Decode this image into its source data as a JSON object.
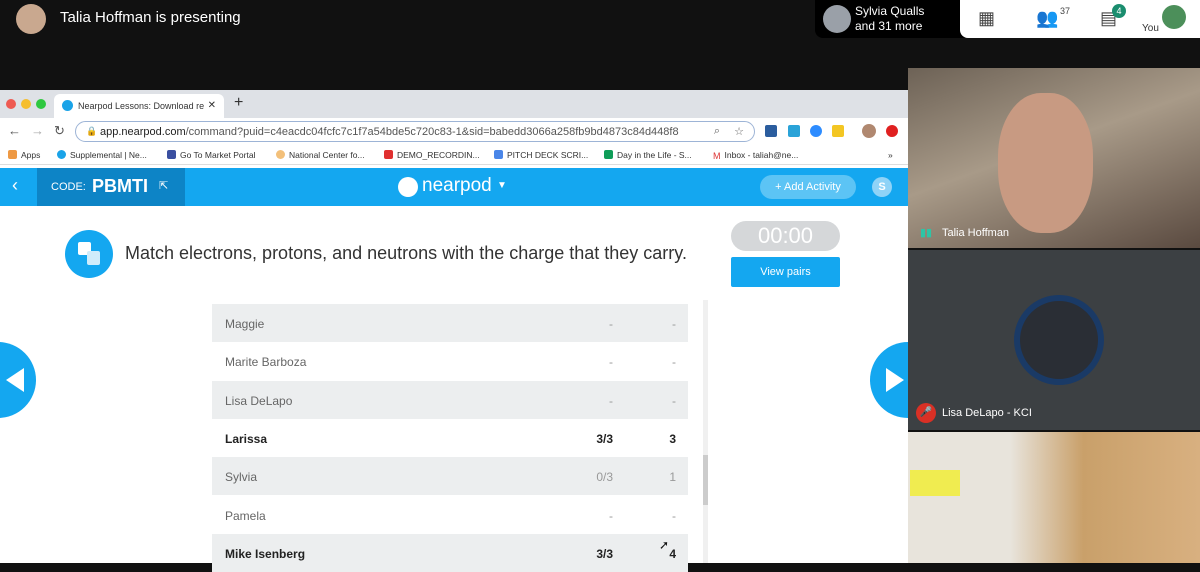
{
  "meet": {
    "presenting": "Talia Hoffman is presenting",
    "participants_pill": {
      "line1": "Sylvia Qualls",
      "line2": "and 31 more"
    },
    "people_count": "37",
    "chat_count": "4",
    "you_label": "You"
  },
  "browser": {
    "tab_title": "Nearpod Lessons: Download re",
    "url_host": "app.nearpod.com",
    "url_rest": "/command?puid=c4eacdc04fcfc7c1f7a54bde5c720c83-1&sid=babedd3066a258fb9bd4873c84d448f8",
    "bookmarks": [
      "Apps",
      "Supplemental | Ne...",
      "Go To Market Portal",
      "National Center fo...",
      "DEMO_RECORDIN...",
      "PITCH DECK SCRI...",
      "Day in the Life - S...",
      "Inbox - taliah@ne..."
    ]
  },
  "nearpod": {
    "code_label": "CODE:",
    "code": "PBMTI",
    "logo": "nearpod",
    "add_activity": "+ Add Activity",
    "user_initial": "S",
    "question": "Match electrons, protons, and neutrons with the charge that they carry.",
    "timer": "00:00",
    "view_pairs": "View pairs",
    "students": [
      {
        "name": "Maggie",
        "score": "-",
        "pairs": "-",
        "bold": false
      },
      {
        "name": "Marite Barboza",
        "score": "-",
        "pairs": "-",
        "bold": false
      },
      {
        "name": "Lisa DeLapo",
        "score": "-",
        "pairs": "-",
        "bold": false
      },
      {
        "name": "Larissa",
        "score": "3/3",
        "pairs": "3",
        "bold": true
      },
      {
        "name": "Sylvia",
        "score": "0/3",
        "pairs": "1",
        "bold": false
      },
      {
        "name": "Pamela",
        "score": "-",
        "pairs": "-",
        "bold": false
      },
      {
        "name": "Mike Isenberg",
        "score": "3/3",
        "pairs": "4",
        "bold": true
      }
    ]
  },
  "tiles": [
    {
      "name": "Talia Hoffman",
      "muted": false
    },
    {
      "name": "Lisa DeLapo - KCI",
      "muted": true
    }
  ]
}
